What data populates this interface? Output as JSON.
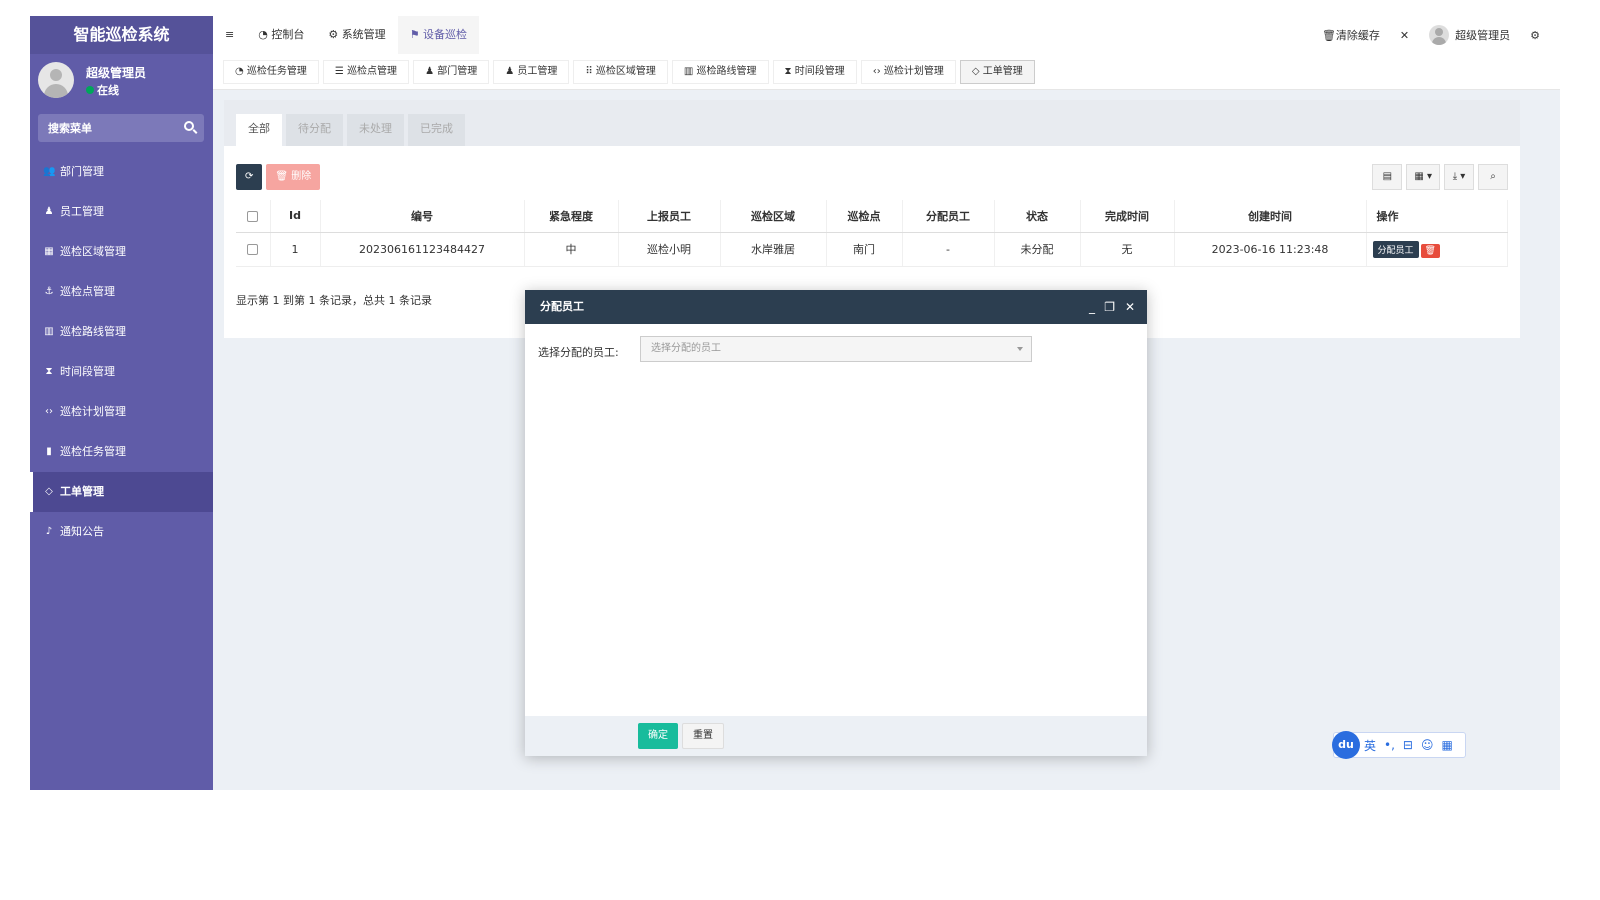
{
  "app": {
    "title": "智能巡检系统"
  },
  "user": {
    "name": "超级管理员",
    "status": "在线"
  },
  "search": {
    "placeholder": "搜索菜单"
  },
  "sidebar": {
    "items": [
      {
        "label": "部门管理",
        "icon": "users-icon"
      },
      {
        "label": "员工管理",
        "icon": "user-icon"
      },
      {
        "label": "巡检区域管理",
        "icon": "grid-icon"
      },
      {
        "label": "巡检点管理",
        "icon": "anchor-icon"
      },
      {
        "label": "巡检路线管理",
        "icon": "map-icon"
      },
      {
        "label": "时间段管理",
        "icon": "hourglass-icon"
      },
      {
        "label": "巡检计划管理",
        "icon": "code-icon"
      },
      {
        "label": "巡检任务管理",
        "icon": "bookmark-icon"
      },
      {
        "label": "工单管理",
        "icon": "diamond-icon",
        "active": true
      },
      {
        "label": "通知公告",
        "icon": "bell-icon"
      }
    ]
  },
  "topnav": {
    "menu": "≡",
    "items": [
      "控制台",
      "系统管理",
      "设备巡检"
    ],
    "active": "设备巡检"
  },
  "topright": {
    "clear_cache": "清除缓存",
    "user": "超级管理员"
  },
  "tabs": [
    "巡检任务管理",
    "巡检点管理",
    "部门管理",
    "员工管理",
    "巡检区域管理",
    "巡检路线管理",
    "时间段管理",
    "巡检计划管理",
    "工单管理"
  ],
  "filter_tabs": [
    "全部",
    "待分配",
    "未处理",
    "已完成"
  ],
  "toolbar": {
    "delete_label": "删除"
  },
  "table": {
    "headers": [
      "Id",
      "编号",
      "紧急程度",
      "上报员工",
      "巡检区域",
      "巡检点",
      "分配员工",
      "状态",
      "完成时间",
      "创建时间",
      "操作"
    ],
    "rows": [
      {
        "id": "1",
        "code": "202306161123484427",
        "urgency": "中",
        "reporter": "巡检小明",
        "area": "水岸雅居",
        "point": "南门",
        "assignee": "-",
        "status": "未分配",
        "done_time": "无",
        "created": "2023-06-16 11:23:48",
        "action_assign": "分配员工"
      }
    ]
  },
  "pager": {
    "text": "显示第 1 到第 1 条记录，总共 1 条记录"
  },
  "modal": {
    "title": "分配员工",
    "field_label": "选择分配的员工:",
    "select_placeholder": "选择分配的员工",
    "ok": "确定",
    "reset": "重置"
  },
  "ime": {
    "logo": "du",
    "lang": "英"
  }
}
